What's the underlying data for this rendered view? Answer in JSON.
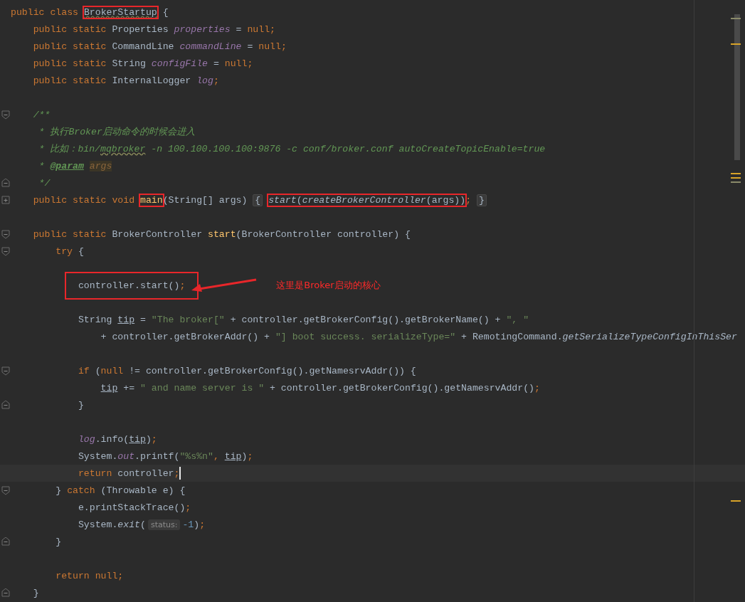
{
  "editor": {
    "lines": [
      {
        "kind": "code",
        "tokens": [
          {
            "kind": "kw",
            "text": "public class "
          },
          {
            "kind": "box",
            "parts": [
              {
                "kind": "typo",
                "text": "BrokerStartup"
              }
            ]
          },
          {
            "kind": "plain",
            "text": " {"
          }
        ],
        "children": [
          {
            "kind": "code",
            "tokens": [
              {
                "kind": "kw",
                "text": "public static "
              },
              {
                "kind": "plain",
                "text": "Properties "
              },
              {
                "kind": "field",
                "text": "properties"
              },
              {
                "kind": "plain",
                "text": " = "
              },
              {
                "kind": "kw",
                "text": "null"
              },
              {
                "kind": "semi",
                "text": ";"
              }
            ]
          },
          {
            "kind": "code",
            "tokens": [
              {
                "kind": "kw",
                "text": "public static "
              },
              {
                "kind": "plain",
                "text": "CommandLine "
              },
              {
                "kind": "field",
                "text": "commandLine"
              },
              {
                "kind": "plain",
                "text": " = "
              },
              {
                "kind": "kw",
                "text": "null"
              },
              {
                "kind": "semi",
                "text": ";"
              }
            ]
          },
          {
            "kind": "code",
            "tokens": [
              {
                "kind": "kw",
                "text": "public static "
              },
              {
                "kind": "plain",
                "text": "String "
              },
              {
                "kind": "field",
                "text": "configFile"
              },
              {
                "kind": "plain",
                "text": " = "
              },
              {
                "kind": "kw",
                "text": "null"
              },
              {
                "kind": "semi",
                "text": ";"
              }
            ]
          },
          {
            "kind": "code",
            "tokens": [
              {
                "kind": "kw",
                "text": "public static "
              },
              {
                "kind": "plain",
                "text": "InternalLogger "
              },
              {
                "kind": "field",
                "text": "log"
              },
              {
                "kind": "semi",
                "text": ";"
              }
            ]
          },
          {
            "kind": "blank"
          },
          {
            "kind": "code",
            "expanded": true,
            "tokens": [
              {
                "kind": "comment",
                "text": "/**"
              }
            ]
          },
          {
            "kind": "code",
            "tokens": [
              {
                "kind": "comment",
                "text": " * 执行Broker启动命令的时候会进入"
              }
            ]
          },
          {
            "kind": "code",
            "tokens": [
              {
                "kind": "comment",
                "text": " * 比如：bin/"
              },
              {
                "kind": "comment-wavy",
                "text": "mqbroker"
              },
              {
                "kind": "comment",
                "text": " -n 100.100.100.100:9876 -c conf/broker.conf autoCreateTopicEnable=true"
              }
            ]
          },
          {
            "kind": "code",
            "tokens": [
              {
                "kind": "comment",
                "text": " * "
              },
              {
                "kind": "doctag",
                "text": "@param"
              },
              {
                "kind": "docref",
                "text": "args"
              }
            ]
          },
          {
            "kind": "code",
            "fold_end": true,
            "tokens": [
              {
                "kind": "comment",
                "text": " */"
              }
            ]
          },
          {
            "kind": "code",
            "expanded": false,
            "tokens": [
              {
                "kind": "kw",
                "text": "public static void "
              },
              {
                "kind": "box",
                "parts": [
                  {
                    "kind": "method",
                    "text": "main"
                  }
                ]
              },
              {
                "kind": "plain",
                "text": "(String[] args) "
              },
              {
                "kind": "fold-brace",
                "text": "{"
              },
              {
                "kind": "box",
                "parts": [
                  {
                    "kind": "static",
                    "text": "start"
                  },
                  {
                    "kind": "plain",
                    "text": "("
                  },
                  {
                    "kind": "static",
                    "text": "createBrokerController"
                  },
                  {
                    "kind": "plain",
                    "text": "(args))"
                  }
                ]
              },
              {
                "kind": "semi",
                "text": "; "
              },
              {
                "kind": "fold-brace",
                "text": "}"
              }
            ]
          },
          {
            "kind": "blank"
          },
          {
            "kind": "code",
            "expanded": true,
            "tokens": [
              {
                "kind": "kw",
                "text": "public static "
              },
              {
                "kind": "plain",
                "text": "BrokerController "
              },
              {
                "kind": "method",
                "text": "start"
              },
              {
                "kind": "plain",
                "text": "(BrokerController controller) {"
              }
            ],
            "children": [
              {
                "kind": "code",
                "expanded": true,
                "tokens": [
                  {
                    "kind": "kw",
                    "text": "try"
                  },
                  {
                    "kind": "plain",
                    "text": " {"
                  }
                ],
                "children": [
                  {
                    "kind": "blank"
                  },
                  {
                    "kind": "code",
                    "note": "这里是Broker启动的核心",
                    "tokens": [
                      {
                        "kind": "box-wide",
                        "parts": [
                          {
                            "kind": "plain",
                            "text": "controller.start()"
                          },
                          {
                            "kind": "semi",
                            "text": ";"
                          }
                        ]
                      }
                    ]
                  },
                  {
                    "kind": "blank"
                  },
                  {
                    "kind": "code",
                    "tokens": [
                      {
                        "kind": "plain",
                        "text": "String "
                      },
                      {
                        "kind": "var",
                        "text": "tip"
                      },
                      {
                        "kind": "plain",
                        "text": " = "
                      },
                      {
                        "kind": "str",
                        "text": "\"The broker[\""
                      },
                      {
                        "kind": "plain",
                        "text": " + controller.getBrokerConfig().getBrokerName() + "
                      },
                      {
                        "kind": "str",
                        "text": "\", \""
                      }
                    ],
                    "children": [
                      {
                        "kind": "code",
                        "tokens": [
                          {
                            "kind": "plain",
                            "text": "+ controller.getBrokerAddr() + "
                          },
                          {
                            "kind": "str",
                            "text": "\"] boot success. serializeType=\""
                          },
                          {
                            "kind": "plain",
                            "text": " + RemotingCommand."
                          },
                          {
                            "kind": "static",
                            "text": "getSerializeTypeConfigInThisSer"
                          }
                        ]
                      }
                    ]
                  },
                  {
                    "kind": "blank"
                  },
                  {
                    "kind": "code",
                    "expanded": true,
                    "tokens": [
                      {
                        "kind": "kw",
                        "text": "if"
                      },
                      {
                        "kind": "plain",
                        "text": " ("
                      },
                      {
                        "kind": "kw",
                        "text": "null"
                      },
                      {
                        "kind": "plain",
                        "text": " != controller.getBrokerConfig().getNamesrvAddr()) {"
                      }
                    ],
                    "children": [
                      {
                        "kind": "code",
                        "tokens": [
                          {
                            "kind": "var",
                            "text": "tip"
                          },
                          {
                            "kind": "plain",
                            "text": " += "
                          },
                          {
                            "kind": "str",
                            "text": "\" and name server is \""
                          },
                          {
                            "kind": "plain",
                            "text": " + controller.getBrokerConfig().getNamesrvAddr()"
                          },
                          {
                            "kind": "semi",
                            "text": ";"
                          }
                        ]
                      }
                    ]
                  },
                  {
                    "kind": "code",
                    "fold_end": true,
                    "tokens": [
                      {
                        "kind": "plain",
                        "text": "}"
                      }
                    ]
                  },
                  {
                    "kind": "blank"
                  },
                  {
                    "kind": "code",
                    "tokens": [
                      {
                        "kind": "sfield",
                        "text": "log"
                      },
                      {
                        "kind": "plain",
                        "text": ".info("
                      },
                      {
                        "kind": "var",
                        "text": "tip"
                      },
                      {
                        "kind": "plain",
                        "text": ")"
                      },
                      {
                        "kind": "semi",
                        "text": ";"
                      }
                    ]
                  },
                  {
                    "kind": "code",
                    "tokens": [
                      {
                        "kind": "plain",
                        "text": "System."
                      },
                      {
                        "kind": "sfield",
                        "text": "out"
                      },
                      {
                        "kind": "plain",
                        "text": ".printf("
                      },
                      {
                        "kind": "str",
                        "text": "\"%s%n\""
                      },
                      {
                        "kind": "semi",
                        "text": ", "
                      },
                      {
                        "kind": "var",
                        "text": "tip"
                      },
                      {
                        "kind": "plain",
                        "text": ")"
                      },
                      {
                        "kind": "semi",
                        "text": ";"
                      }
                    ]
                  },
                  {
                    "kind": "code",
                    "current": true,
                    "tokens": [
                      {
                        "kind": "kw",
                        "text": "return"
                      },
                      {
                        "kind": "plain",
                        "text": " controller"
                      },
                      {
                        "kind": "semi",
                        "text": ";"
                      }
                    ]
                  }
                ]
              },
              {
                "kind": "code",
                "expanded": true,
                "tokens": [
                  {
                    "kind": "plain",
                    "text": "} "
                  },
                  {
                    "kind": "kw",
                    "text": "catch"
                  },
                  {
                    "kind": "plain",
                    "text": " (Throwable e) {"
                  }
                ],
                "children": [
                  {
                    "kind": "code",
                    "tokens": [
                      {
                        "kind": "plain",
                        "text": "e.printStackTrace()"
                      },
                      {
                        "kind": "semi",
                        "text": ";"
                      }
                    ]
                  },
                  {
                    "kind": "code",
                    "tokens": [
                      {
                        "kind": "plain",
                        "text": "System."
                      },
                      {
                        "kind": "static",
                        "text": "exit"
                      },
                      {
                        "kind": "plain",
                        "text": "("
                      },
                      {
                        "kind": "hint",
                        "text": "status:"
                      },
                      {
                        "kind": "num",
                        "text": "-1"
                      },
                      {
                        "kind": "plain",
                        "text": ")"
                      },
                      {
                        "kind": "semi",
                        "text": ";"
                      }
                    ]
                  }
                ]
              },
              {
                "kind": "code",
                "fold_end": true,
                "tokens": [
                  {
                    "kind": "plain",
                    "text": "}"
                  }
                ]
              },
              {
                "kind": "blank"
              },
              {
                "kind": "code",
                "tokens": [
                  {
                    "kind": "kw",
                    "text": "return null"
                  },
                  {
                    "kind": "semi",
                    "text": ";"
                  }
                ]
              }
            ]
          },
          {
            "kind": "code",
            "fold_end": true,
            "tokens": [
              {
                "kind": "plain",
                "text": "}"
              }
            ]
          }
        ]
      }
    ]
  }
}
